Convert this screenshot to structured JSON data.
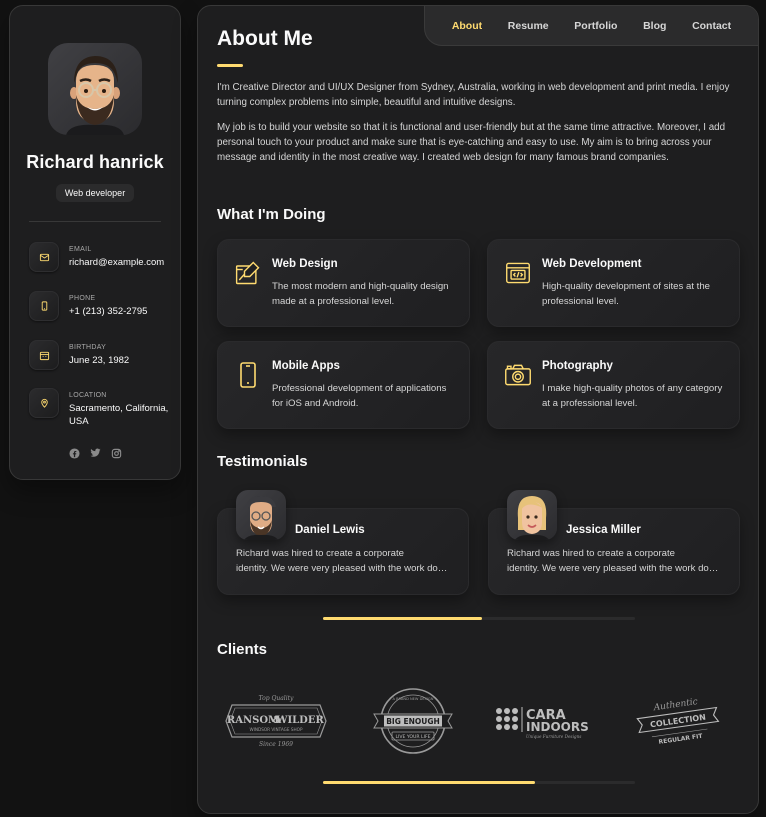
{
  "profile": {
    "name": "Richard hanrick",
    "title": "Web developer"
  },
  "contacts": [
    {
      "label": "Email",
      "value": "richard@example.com",
      "icon": "mail-icon"
    },
    {
      "label": "Phone",
      "value": "+1 (213) 352-2795",
      "icon": "phone-icon"
    },
    {
      "label": "Birthday",
      "value": "June 23, 1982",
      "icon": "calendar-icon"
    },
    {
      "label": "Location",
      "value": "Sacramento, California, USA",
      "icon": "location-icon"
    }
  ],
  "socials": [
    "facebook-icon",
    "twitter-icon",
    "instagram-icon"
  ],
  "nav": [
    "About",
    "Resume",
    "Portfolio",
    "Blog",
    "Contact"
  ],
  "about": {
    "heading": "About Me",
    "p1": "I'm Creative Director and UI/UX Designer from Sydney, Australia, working in web development and print media. I enjoy turning complex problems into simple, beautiful and intuitive designs.",
    "p2": "My job is to build your website so that it is functional and user-friendly but at the same time attractive. Moreover, I add personal touch to your product and make sure that is eye-catching and easy to use. My aim is to bring across your message and identity in the most creative way. I created web design for many famous brand companies."
  },
  "services": {
    "heading": "What I'm Doing",
    "items": [
      {
        "title": "Web Design",
        "text": "The most modern and high-quality design made at a professional level.",
        "icon": "design-icon"
      },
      {
        "title": "Web Development",
        "text": "High-quality development of sites at the professional level.",
        "icon": "code-icon"
      },
      {
        "title": "Mobile Apps",
        "text": "Professional development of applications for iOS and Android.",
        "icon": "mobile-icon"
      },
      {
        "title": "Photography",
        "text": "I make high-quality photos of any category at a professional level.",
        "icon": "camera-icon"
      }
    ]
  },
  "testimonials": {
    "heading": "Testimonials",
    "items": [
      {
        "name": "Daniel Lewis",
        "line1": "Richard was hired to create a corporate",
        "line2": "identity. We were very pleased with the work done."
      },
      {
        "name": "Jessica Miller",
        "line1": "Richard was hired to create a corporate",
        "line2": "identity. We were very pleased with the work done."
      }
    ],
    "scroll_progress": 0.51
  },
  "clients": {
    "heading": "Clients",
    "logos": [
      {
        "top": "Top Quality",
        "main1": "RANSOM",
        "main2": "&",
        "main3": "WILDER",
        "sub": "WINDSOR VINTAGE SHOP",
        "since": "Since 1969"
      },
      {
        "ring_top": "A BRAND NEW DESIGN",
        "main": "BIG ENOUGH",
        "sub": "LIVE YOUR LIFE"
      },
      {
        "main1": "CARA",
        "main2": "INDOORS",
        "sub": "Unique Furniture Designs"
      },
      {
        "top": "Authentic",
        "main": "COLLECTION",
        "sub": "REGULAR FIT"
      }
    ],
    "scroll_progress": 0.68
  },
  "colors": {
    "accent": "#ffdb70",
    "bg": "#121212",
    "card": "#1e1e1f"
  }
}
